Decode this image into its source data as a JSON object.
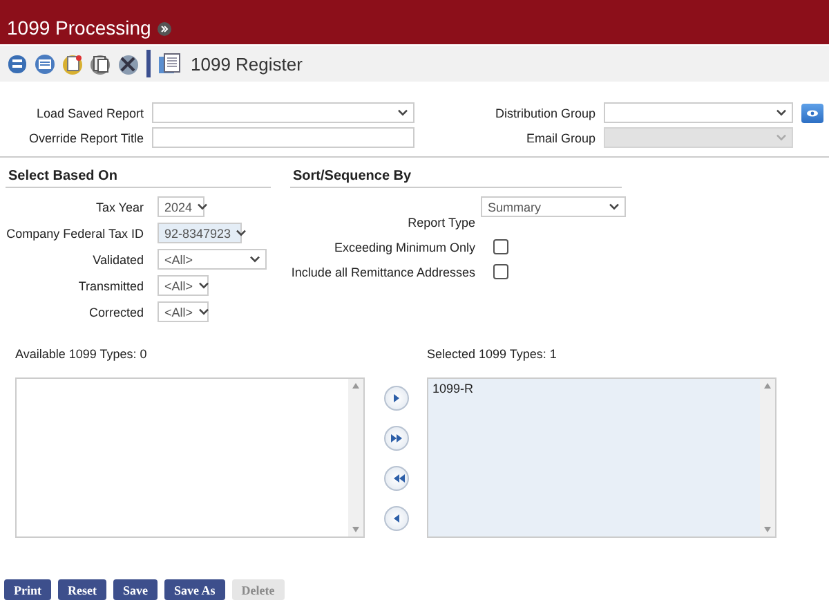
{
  "header": {
    "title": "1099 Processing"
  },
  "toolbar": {
    "title": "1099 Register"
  },
  "report_options": [
    {
      "kind": "select",
      "label": "Load Saved Report",
      "disabled": false
    },
    {
      "kind": "select_lookup",
      "label": "Distribution Group",
      "disabled": false
    },
    {
      "kind": "text",
      "label": "Override Report Title",
      "disabled": false
    },
    {
      "kind": "select",
      "label": "Email Group",
      "disabled": true
    }
  ],
  "select_based_on": {
    "heading": "Select Based On",
    "fields": [
      {
        "label": "Tax Year",
        "value": "2024",
        "highlighted": false
      },
      {
        "label": "Company Federal Tax ID",
        "value": "92-8347923",
        "highlighted": true
      },
      {
        "label": "Validated",
        "value": "<All>",
        "highlighted": false
      },
      {
        "label": "Transmitted",
        "value": "<All>",
        "highlighted": false
      },
      {
        "label": "Corrected",
        "value": "<All>",
        "highlighted": false
      }
    ]
  },
  "sort_sequence_by": {
    "heading": "Sort/Sequence By",
    "fields": [
      {
        "kind": "select",
        "label": "Report Type",
        "value": "Summary"
      },
      {
        "kind": "checkbox",
        "label": "Exceeding Minimum Only",
        "checked": false
      },
      {
        "kind": "checkbox",
        "label": "Include all Remittance Addresses",
        "checked": false
      }
    ]
  },
  "available_types": {
    "label": "Available 1099 Types: 0"
  },
  "selected_types": {
    "label": "Selected 1099 Types: 1",
    "items": [
      "1099-R"
    ]
  },
  "actions": [
    {
      "label": "Print",
      "disabled": false
    },
    {
      "label": "Reset",
      "disabled": false
    },
    {
      "label": "Save",
      "disabled": false
    },
    {
      "label": "Save As",
      "disabled": false
    },
    {
      "label": "Delete",
      "disabled": true
    }
  ]
}
